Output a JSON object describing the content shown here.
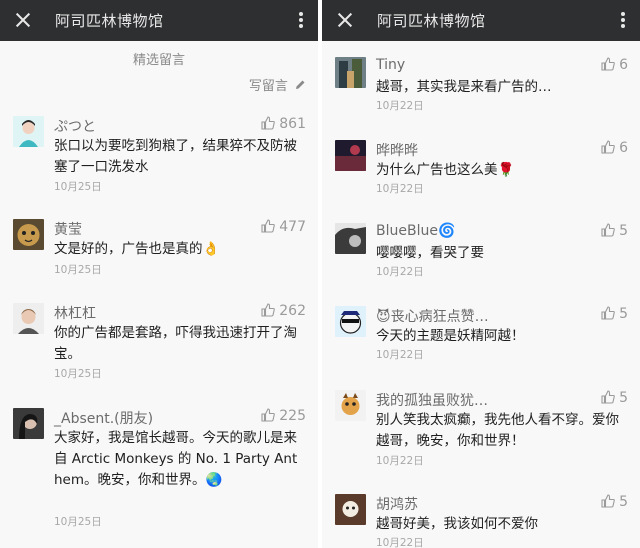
{
  "left": {
    "title": "阿司匹林博物馆",
    "section_title": "精选留言",
    "write_label": "写留言",
    "comments": [
      {
        "name": "ぷつと",
        "likes": "861",
        "text": "张口以为要吃到狗粮了，结果猝不及防被塞了一口洗发水",
        "date": "10月25日"
      },
      {
        "name": "黄莹",
        "likes": "477",
        "text": "文是好的，广告也是真的👌",
        "date": "10月25日"
      },
      {
        "name": "林杠杠",
        "likes": "262",
        "text": "你的广告都是套路，吓得我迅速打开了淘宝。",
        "date": "10月25日"
      },
      {
        "name": "_Absent.(朋友)",
        "likes": "225",
        "text": "大家好，我是馆长越哥。今天的歌儿是来",
        "text2": "自 Arctic Monkeys 的 No. 1 Party Ant",
        "text3": "hem。晚安，你和世界。🌏",
        "date": "10月25日"
      }
    ]
  },
  "right": {
    "title": "阿司匹林博物馆",
    "comments": [
      {
        "name": "Tiny",
        "likes": "6",
        "text": "越哥，其实我是来看广告的…",
        "date": "10月22日"
      },
      {
        "name": "晔晔晔",
        "likes": "6",
        "text": "为什么广告也这么美🌹",
        "date": "10月22日"
      },
      {
        "name": "BlueBlue🌀",
        "likes": "5",
        "text": "嘤嘤嘤，看哭了要",
        "date": "10月22日"
      },
      {
        "name": "😈丧心病狂点赞…",
        "likes": "5",
        "text": "今天的主题是妖精阿越！",
        "date": "10月22日"
      },
      {
        "name": "我的孤独虽败犹…",
        "likes": "5",
        "text": "别人笑我太疯癫，我先他人看不穿。爱你越哥，晚安，你和世界！",
        "date": "10月22日"
      },
      {
        "name": "胡鸿苏",
        "likes": "5",
        "text": "越哥好美，我该如何不爱你",
        "date": "10月22日"
      }
    ]
  }
}
